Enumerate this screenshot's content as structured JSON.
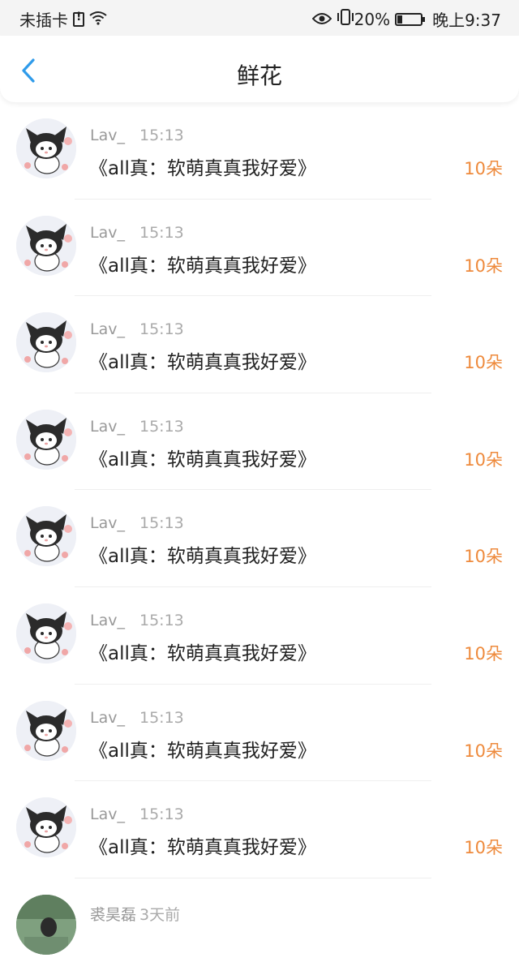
{
  "status_bar": {
    "carrier": "未插卡",
    "battery_percent": "20%",
    "battery_level": 0.2,
    "time": "晚上9:37",
    "icons": [
      "sim-alert-icon",
      "wifi-icon",
      "eye-icon",
      "vibrate-icon",
      "battery-icon"
    ]
  },
  "header": {
    "title": "鲜花",
    "back_icon": "chevron-left-icon",
    "accent_color": "#2f9bea"
  },
  "list": [
    {
      "user": "Lav_",
      "time": "15:13",
      "book": "《all真：软萌真真我好爱》",
      "amount": "10朵"
    },
    {
      "user": "Lav_",
      "time": "15:13",
      "book": "《all真：软萌真真我好爱》",
      "amount": "10朵"
    },
    {
      "user": "Lav_",
      "time": "15:13",
      "book": "《all真：软萌真真我好爱》",
      "amount": "10朵"
    },
    {
      "user": "Lav_",
      "time": "15:13",
      "book": "《all真：软萌真真我好爱》",
      "amount": "10朵"
    },
    {
      "user": "Lav_",
      "time": "15:13",
      "book": "《all真：软萌真真我好爱》",
      "amount": "10朵"
    },
    {
      "user": "Lav_",
      "time": "15:13",
      "book": "《all真：软萌真真我好爱》",
      "amount": "10朵"
    },
    {
      "user": "Lav_",
      "time": "15:13",
      "book": "《all真：软萌真真我好爱》",
      "amount": "10朵"
    },
    {
      "user": "Lav_",
      "time": "15:13",
      "book": "《all真：软萌真真我好爱》",
      "amount": "10朵"
    },
    {
      "user": "裘昊磊",
      "time": "3天前",
      "book": "",
      "amount": ""
    }
  ],
  "colors": {
    "amount": "#ee8a3c",
    "meta_text": "#999999",
    "title_text": "#222222"
  }
}
